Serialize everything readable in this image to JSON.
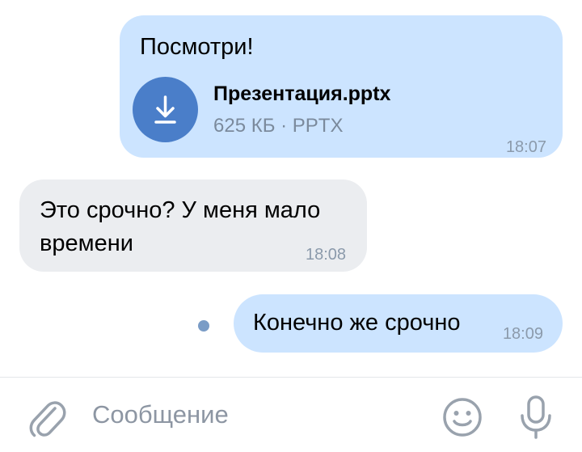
{
  "messages": [
    {
      "direction": "outgoing",
      "text": "Посмотри!",
      "attachment": {
        "icon": "download-icon",
        "name": "Презентация.pptx",
        "meta": "625 КБ · PPTX"
      },
      "time": "18:07"
    },
    {
      "direction": "incoming",
      "text": "Это срочно? У меня мало времени",
      "time": "18:08"
    },
    {
      "direction": "outgoing",
      "text": "Конечно же срочно",
      "time": "18:09",
      "unread": true
    }
  ],
  "composer": {
    "placeholder": "Сообщение",
    "value": "",
    "icons": [
      "paperclip-icon",
      "emoji-icon",
      "microphone-icon"
    ]
  },
  "colors": {
    "outgoing_bubble": "#cce4ff",
    "incoming_bubble": "#ebedf0",
    "accent": "#4a7ec9",
    "icon_gray": "#99a2ad"
  }
}
